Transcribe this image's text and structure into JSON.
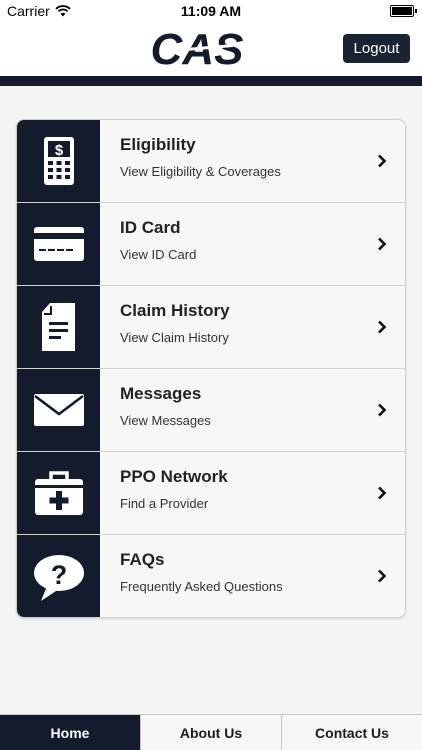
{
  "status": {
    "carrier": "Carrier",
    "time": "11:09 AM"
  },
  "header": {
    "logo_text": "CAS",
    "logout_label": "Logout"
  },
  "menu": [
    {
      "title": "Eligibility",
      "subtitle": "View Eligibility & Coverages",
      "icon": "calculator-icon"
    },
    {
      "title": "ID Card",
      "subtitle": "View ID Card",
      "icon": "credit-card-icon"
    },
    {
      "title": "Claim History",
      "subtitle": "View Claim History",
      "icon": "document-icon"
    },
    {
      "title": "Messages",
      "subtitle": "View Messages",
      "icon": "envelope-icon"
    },
    {
      "title": "PPO Network",
      "subtitle": "Find a Provider",
      "icon": "medical-kit-icon"
    },
    {
      "title": "FAQs",
      "subtitle": "Frequently Asked Questions",
      "icon": "question-bubble-icon"
    }
  ],
  "tabs": [
    {
      "label": "Home",
      "active": true
    },
    {
      "label": "About Us",
      "active": false
    },
    {
      "label": "Contact Us",
      "active": false
    }
  ],
  "colors": {
    "navy": "#131b2c",
    "button": "#1b2333",
    "background": "#f4f4f4"
  }
}
